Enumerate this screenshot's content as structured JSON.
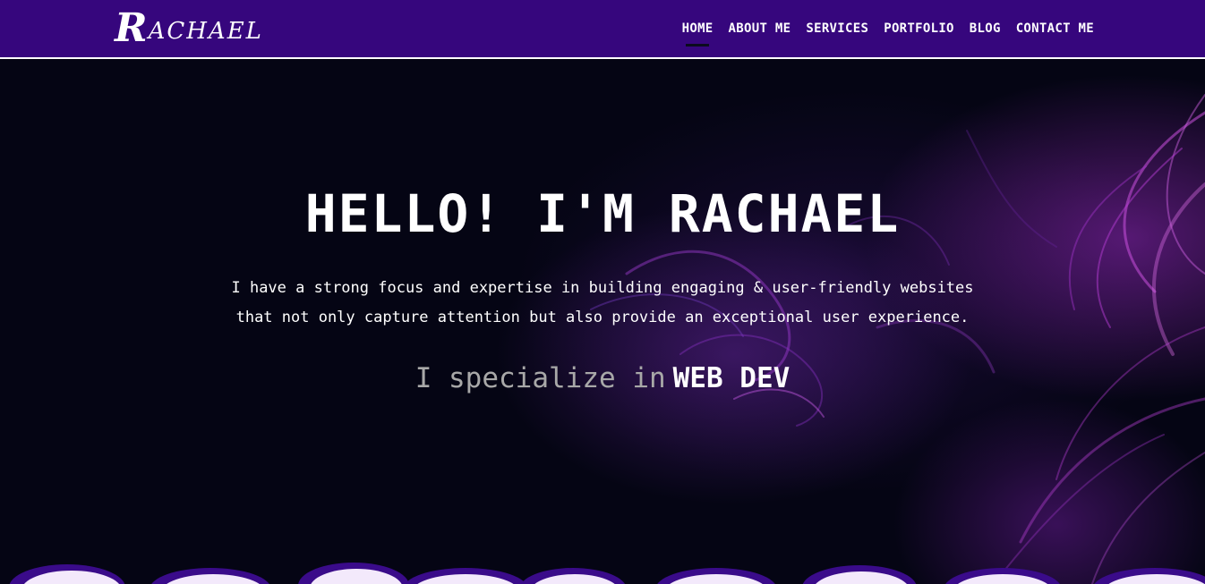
{
  "header": {
    "logo": {
      "initial": "R",
      "rest": "ACHAEL"
    },
    "nav": [
      {
        "label": "HOME",
        "active": true
      },
      {
        "label": "ABOUT ME",
        "active": false
      },
      {
        "label": "SERVICES",
        "active": false
      },
      {
        "label": "PORTFOLIO",
        "active": false
      },
      {
        "label": "BLOG",
        "active": false
      },
      {
        "label": "CONTACT ME",
        "active": false
      }
    ]
  },
  "hero": {
    "title": "HELLO! I'M RACHAEL",
    "description_line1": "I have a strong focus and expertise in building engaging & user-friendly websites",
    "description_line2": "that not only capture attention but also provide an exceptional user experience.",
    "specialize_prefix": "I specialize in",
    "specialize_word": "WEB DEV"
  },
  "colors": {
    "header_bg": "#36067d",
    "hero_bg": "#050514",
    "accent_purple": "#9b2fc4",
    "cloud_fill": "#f3e9fb"
  }
}
